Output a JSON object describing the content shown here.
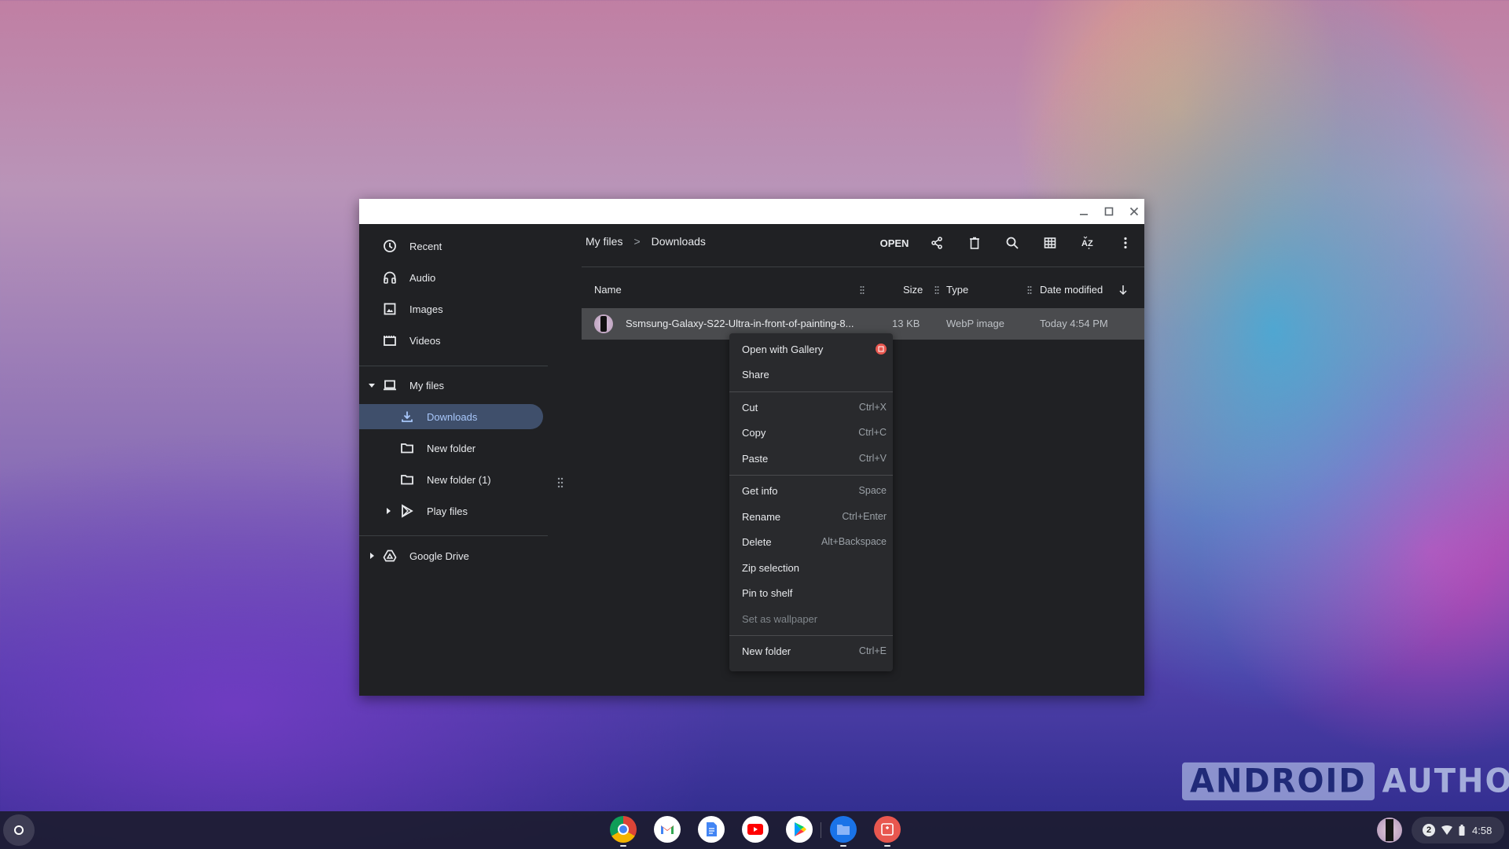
{
  "window": {
    "controls": [
      "minimize",
      "maximize",
      "close"
    ]
  },
  "sidebar": {
    "quick": [
      {
        "label": "Recent",
        "icon": "clock-icon"
      },
      {
        "label": "Audio",
        "icon": "headphones-icon"
      },
      {
        "label": "Images",
        "icon": "image-icon"
      },
      {
        "label": "Videos",
        "icon": "video-icon"
      }
    ],
    "my_files": {
      "label": "My files",
      "icon": "laptop-icon",
      "expanded": true
    },
    "children": [
      {
        "label": "Downloads",
        "icon": "download-icon",
        "selected": true
      },
      {
        "label": "New folder",
        "icon": "folder-icon"
      },
      {
        "label": "New folder (1)",
        "icon": "folder-icon"
      },
      {
        "label": "Play files",
        "icon": "play-store-icon",
        "expandable": true
      }
    ],
    "google_drive": {
      "label": "Google Drive",
      "icon": "drive-icon"
    }
  },
  "breadcrumb": {
    "root": "My files",
    "separator": ">",
    "current": "Downloads"
  },
  "toolbar": {
    "open_label": "OPEN",
    "buttons": [
      "share-icon",
      "delete-icon",
      "search-icon",
      "grid-view-icon",
      "sort-icon",
      "more-icon"
    ]
  },
  "columns": {
    "name": "Name",
    "size": "Size",
    "type": "Type",
    "date": "Date modified",
    "sort_direction": "descending"
  },
  "files": [
    {
      "name": "Ssmsung-Galaxy-S22-Ultra-in-front-of-painting-8...",
      "size": "13 KB",
      "type": "WebP image",
      "date": "Today 4:54 PM",
      "selected": true
    }
  ],
  "context_menu": {
    "groups": [
      [
        {
          "label": "Open with Gallery",
          "badge": "gallery-icon"
        },
        {
          "label": "Share"
        }
      ],
      [
        {
          "label": "Cut",
          "shortcut": "Ctrl+X"
        },
        {
          "label": "Copy",
          "shortcut": "Ctrl+C"
        },
        {
          "label": "Paste",
          "shortcut": "Ctrl+V"
        }
      ],
      [
        {
          "label": "Get info",
          "shortcut": "Space"
        },
        {
          "label": "Rename",
          "shortcut": "Ctrl+Enter"
        },
        {
          "label": "Delete",
          "shortcut": "Alt+Backspace"
        },
        {
          "label": "Zip selection"
        },
        {
          "label": "Pin to shelf"
        },
        {
          "label": "Set as wallpaper",
          "disabled": true
        }
      ],
      [
        {
          "label": "New folder",
          "shortcut": "Ctrl+E"
        }
      ]
    ]
  },
  "shelf": {
    "apps": [
      {
        "name": "Chrome",
        "running": true
      },
      {
        "name": "Gmail",
        "running": false
      },
      {
        "name": "Docs",
        "running": false
      },
      {
        "name": "YouTube",
        "running": false
      },
      {
        "name": "Play Store",
        "running": false
      },
      {
        "name": "Files",
        "running": true
      },
      {
        "name": "Gallery",
        "running": true
      }
    ],
    "tray": {
      "notification_count": "2",
      "time": "4:58"
    }
  },
  "watermark": {
    "boxed": "ANDROID",
    "text": "AUTHORITY"
  }
}
